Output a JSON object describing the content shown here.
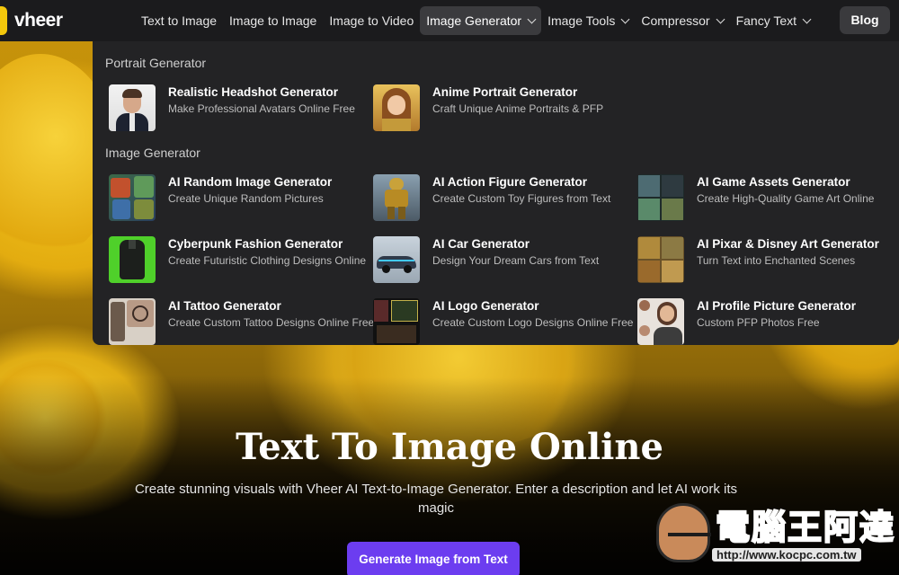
{
  "brand": {
    "name": "vheer",
    "accent": "#f4c80c"
  },
  "nav": {
    "items": [
      {
        "label": "Text to Image",
        "has_menu": false
      },
      {
        "label": "Image to Image",
        "has_menu": false
      },
      {
        "label": "Image to Video",
        "has_menu": false
      },
      {
        "label": "Image Generator",
        "has_menu": true,
        "active": true
      },
      {
        "label": "Image Tools",
        "has_menu": true
      },
      {
        "label": "Compressor",
        "has_menu": true
      },
      {
        "label": "Fancy Text",
        "has_menu": true
      }
    ],
    "blog_label": "Blog"
  },
  "dropdown": {
    "portrait_section": {
      "title": "Portrait Generator",
      "items": [
        {
          "title": "Realistic Headshot Generator",
          "desc": "Make Professional Avatars Online Free"
        },
        {
          "title": "Anime Portrait Generator",
          "desc": "Craft Unique Anime Portraits & PFP"
        }
      ]
    },
    "image_section": {
      "title": "Image Generator",
      "items": [
        {
          "title": "AI Random Image Generator",
          "desc": "Create Unique Random Pictures"
        },
        {
          "title": "AI Action Figure Generator",
          "desc": "Create Custom Toy Figures from Text"
        },
        {
          "title": "AI Game Assets Generator",
          "desc": "Create High-Quality Game Art Online"
        },
        {
          "title": "Cyberpunk Fashion Generator",
          "desc": "Create Futuristic Clothing Designs Online"
        },
        {
          "title": "AI Car Generator",
          "desc": "Design Your Dream Cars from Text"
        },
        {
          "title": "AI Pixar & Disney Art Generator",
          "desc": "Turn Text into Enchanted Scenes"
        },
        {
          "title": "AI Tattoo Generator",
          "desc": "Create Custom Tattoo Designs Online Free"
        },
        {
          "title": "AI Logo Generator",
          "desc": "Create Custom Logo Designs Online Free"
        },
        {
          "title": "AI Profile Picture Generator",
          "desc": "Custom PFP Photos Free"
        }
      ]
    }
  },
  "hero": {
    "title": "Text To Image Online",
    "subtitle": "Create stunning visuals with Vheer AI Text-to-Image Generator. Enter a description and let AI work its magic",
    "cta_label": "Generate Image from Text",
    "cta_color": "#6c3df0"
  },
  "watermark": {
    "text": "電腦王阿達",
    "url": "http://www.kocpc.com.tw"
  }
}
